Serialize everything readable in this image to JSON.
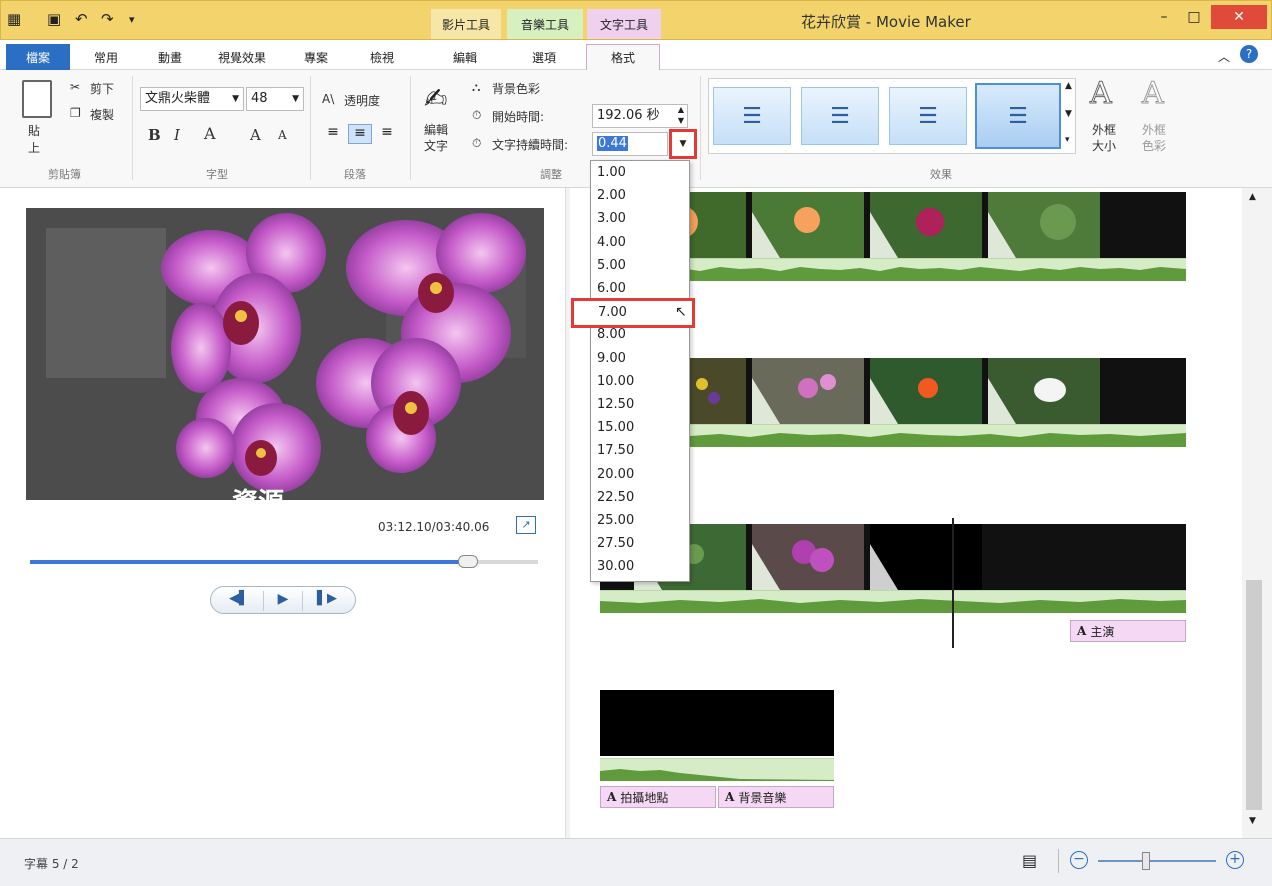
{
  "window": {
    "title": "花卉欣賞 - Movie Maker",
    "context_tabs": [
      "影片工具",
      "音樂工具",
      "文字工具"
    ],
    "context_subtabs": [
      "編輯",
      "選項",
      "格式"
    ],
    "min": "–",
    "max": "□",
    "close": "✕"
  },
  "tabs": [
    "檔案",
    "常用",
    "動畫",
    "視覺效果",
    "專案",
    "檢視"
  ],
  "ribbon": {
    "clipboard": {
      "paste": "貼上",
      "cut": "剪下",
      "copy": "複製",
      "label": "剪貼簿"
    },
    "font": {
      "family": "文鼎火柴體",
      "size": "48",
      "bold": "B",
      "italic": "I",
      "color": "A",
      "grow": "A",
      "shrink": "A",
      "label": "字型"
    },
    "paragraph": {
      "transparency": "透明度",
      "label": "段落"
    },
    "adjust": {
      "edit_text": "編輯文字",
      "bg_color": "背景色彩",
      "start_time_label": "開始時間:",
      "start_time_value": "192.06 秒",
      "duration_label": "文字持續時間:",
      "duration_value": "0.44",
      "label": "調整"
    },
    "effects": {
      "outline_size": "外框大小",
      "outline_color": "外框色彩",
      "label": "效果"
    }
  },
  "preview": {
    "time": "03:12.10/03:40.06",
    "overlay_text": "資源"
  },
  "dropdown": {
    "options": [
      "1.00",
      "2.00",
      "3.00",
      "4.00",
      "5.00",
      "6.00",
      "7.00",
      "8.00",
      "9.00",
      "10.00",
      "12.50",
      "15.00",
      "17.50",
      "20.00",
      "22.50",
      "25.00",
      "27.50",
      "30.00"
    ],
    "highlighted": "7.00"
  },
  "captions": {
    "main": "主演",
    "location": "拍攝地點",
    "music": "背景音樂"
  },
  "status": {
    "text": "字幕 5 / 2"
  },
  "colors": {
    "accent": "#2b6fc4",
    "highlight_box": "#e53935",
    "title_bar": "#f3d36b"
  }
}
